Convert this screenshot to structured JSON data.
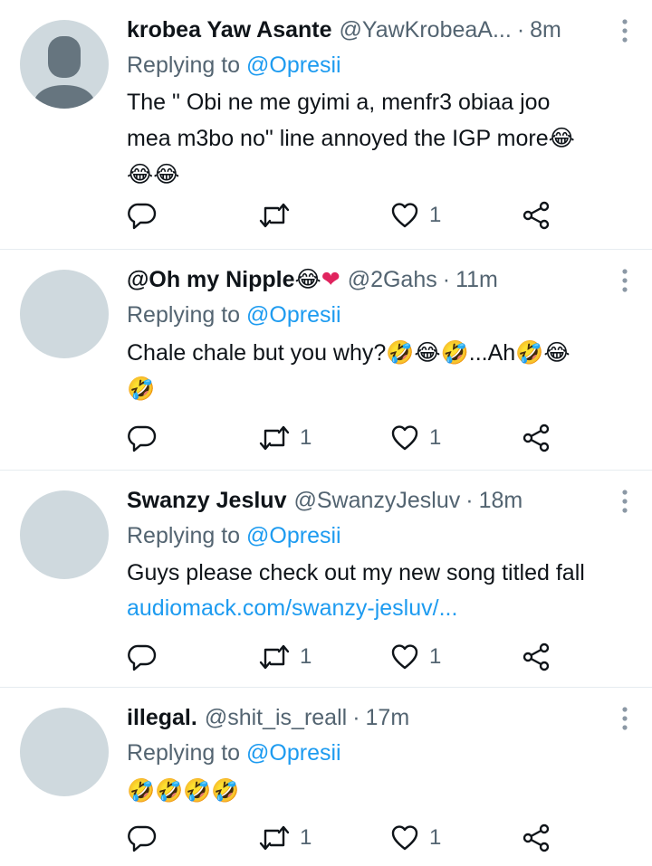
{
  "replying_prefix": "Replying to",
  "tweets": [
    {
      "name": "krobea Yaw Asante",
      "handle": "@YawKrobeaA...",
      "time": "8m",
      "mention": "@Opresii",
      "text_line1": "The \" Obi ne me gyimi a, menfr3 obiaa joo",
      "text_line2": "mea m3bo no\" line annoyed the IGP more",
      "emoji_inline": "😂",
      "text_line3_emoji": "😂😂",
      "retweets": "",
      "likes": "1",
      "avatar": "default-avatar"
    },
    {
      "name": "@Oh my Nipple",
      "name_emoji": "😂",
      "name_heart": "❤",
      "handle": "@2Gahs",
      "time": "11m",
      "mention": "@Opresii",
      "text_line1": "Chale chale but you why?",
      "text_emoji_a": "🤣😂🤣",
      "text_mid": "...Ah",
      "text_emoji_b": "🤣😂",
      "text_line2_emoji": "🤣",
      "retweets": "1",
      "likes": "1"
    },
    {
      "name": "Swanzy Jesluv",
      "handle": "@SwanzyJesluv",
      "time": "18m",
      "mention": "@Opresii",
      "text_line1": "Guys please check out my new song titled fall",
      "link": "audiomack.com/swanzy-jesluv/...",
      "retweets": "1",
      "likes": "1"
    },
    {
      "name": "illegal.",
      "handle": "@shit_is_reall",
      "time": "17m",
      "mention": "@Opresii",
      "text_emoji": "🤣🤣🤣🤣",
      "retweets": "1",
      "likes": "1"
    }
  ],
  "colors": {
    "accent": "#1d9bf0",
    "secondary_text": "#536471",
    "avatar_placeholder": "#cfd9de",
    "divider": "#e6ecf0"
  },
  "icons": [
    "reply-icon",
    "retweet-icon",
    "like-icon",
    "share-icon",
    "more-icon"
  ]
}
